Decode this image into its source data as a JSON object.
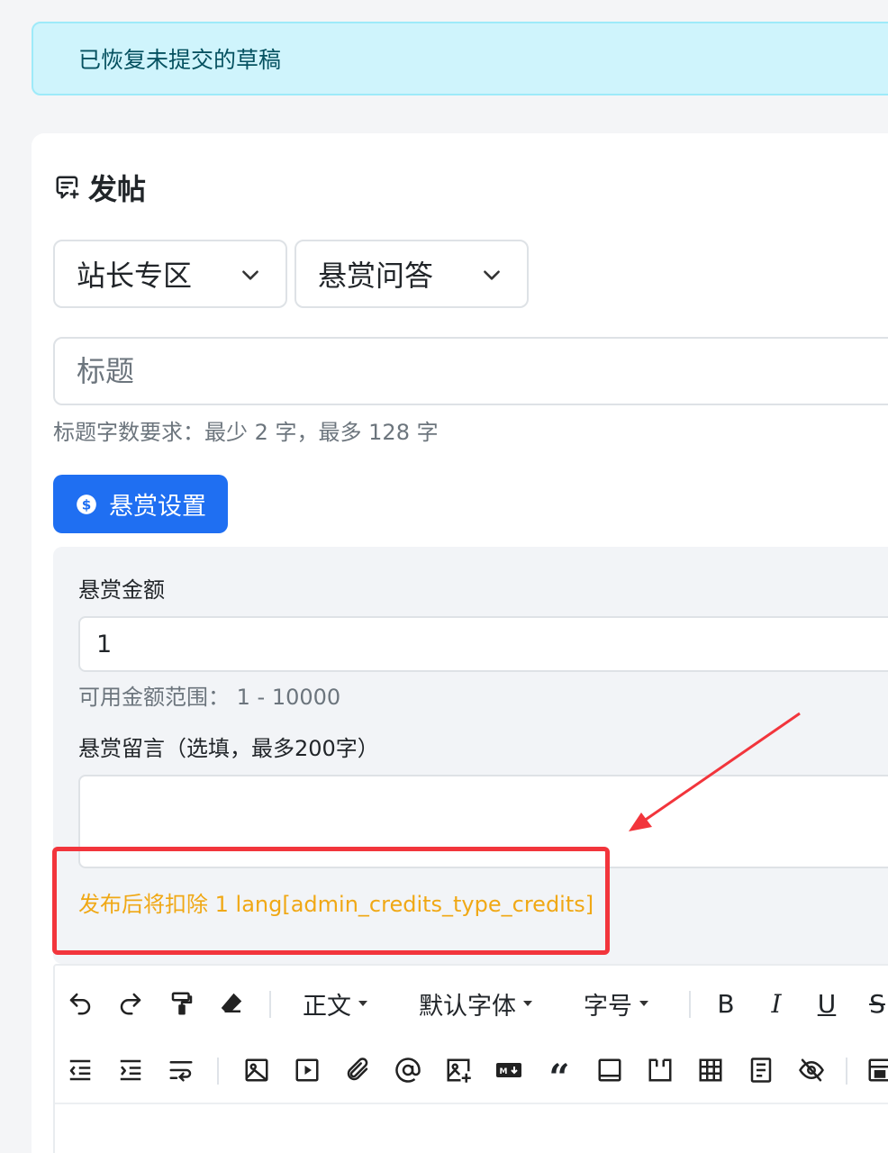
{
  "alert": {
    "message": "已恢复未提交的草稿"
  },
  "page": {
    "title": "发帖"
  },
  "selects": {
    "forum": "站长专区",
    "post_type": "悬赏问答"
  },
  "title_field": {
    "placeholder": "标题",
    "help": "标题字数要求：最少 2 字，最多 128 字"
  },
  "reward_button": {
    "label": "悬赏设置"
  },
  "reward": {
    "amount_label": "悬赏金额",
    "amount_value": "1",
    "range_text": "可用金额范围： 1 - 10000",
    "message_label": "悬赏留言（选填，最多200字）",
    "message_value": "",
    "deduct_text": "发布后将扣除 1 lang[admin_credits_type_credits]"
  },
  "annotation": {
    "highlight_color": "#f2353c"
  },
  "toolbar": {
    "paragraph": "正文",
    "font_family": "默认字体",
    "font_size": "字号",
    "bold": "B",
    "italic": "I",
    "underline": "U",
    "strike": "S",
    "quote": "“",
    "row1_icons": [
      "undo-icon",
      "redo-icon",
      "format-painter-icon",
      "eraser-icon"
    ],
    "row2_icons": [
      "outdent-icon",
      "indent-icon",
      "line-wrap-icon",
      "image-icon",
      "video-icon",
      "attachment-icon",
      "mention-icon",
      "image-edit-icon",
      "markdown-icon",
      "quote-icon",
      "horizontal-rule-icon",
      "code-block-icon",
      "table-icon",
      "document-icon",
      "hide-content-icon",
      "layout-icon"
    ]
  },
  "colors": {
    "primary": "#1f6ff2",
    "alert_bg": "#cff4fc",
    "alert_text": "#055160",
    "warning_text": "#f0a815"
  }
}
